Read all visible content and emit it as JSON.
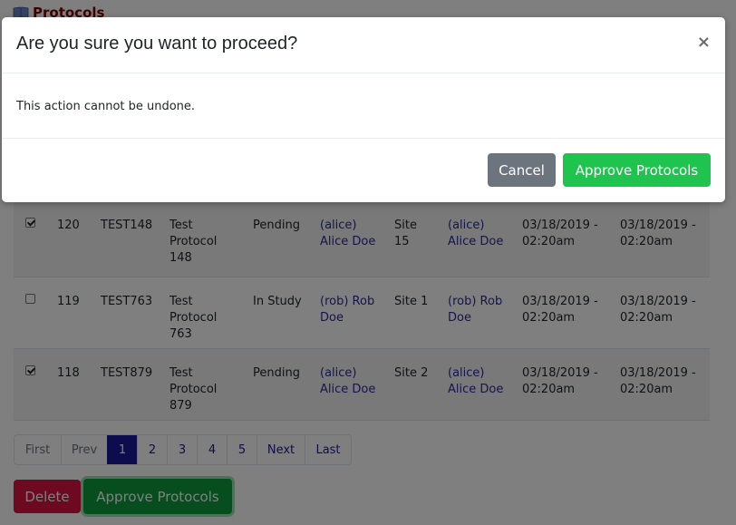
{
  "page": {
    "title": "Protocols"
  },
  "rows": [
    {
      "checked": true,
      "id": "120",
      "code": "TEST148",
      "name": [
        "Test",
        "Protocol",
        "148"
      ],
      "status": "Pending",
      "user": [
        "(alice)",
        "Alice Doe"
      ],
      "site": [
        "Site",
        "15"
      ],
      "user2": [
        "(alice)",
        "Alice Doe"
      ],
      "date1": [
        "03/18/2019 -",
        "02:20am"
      ],
      "date2": [
        "03/18/2019 -",
        "02:20am"
      ]
    },
    {
      "checked": false,
      "id": "119",
      "code": "TEST763",
      "name": [
        "Test",
        "Protocol",
        "763"
      ],
      "status": "In Study",
      "user": [
        "(rob) Rob",
        "Doe"
      ],
      "site": [
        "Site 1",
        ""
      ],
      "user2": [
        "(rob) Rob",
        "Doe"
      ],
      "date1": [
        "03/18/2019 -",
        "02:20am"
      ],
      "date2": [
        "03/18/2019 -",
        "02:20am"
      ]
    },
    {
      "checked": true,
      "id": "118",
      "code": "TEST879",
      "name": [
        "Test",
        "Protocol",
        "879"
      ],
      "status": "Pending",
      "user": [
        "(alice)",
        "Alice Doe"
      ],
      "site": [
        "Site 2",
        ""
      ],
      "user2": [
        "(alice)",
        "Alice Doe"
      ],
      "date1": [
        "03/18/2019 -",
        "02:20am"
      ],
      "date2": [
        "03/18/2019 -",
        "02:20am"
      ]
    }
  ],
  "pagination": {
    "first": "First",
    "prev": "Prev",
    "pages": [
      "1",
      "2",
      "3",
      "4",
      "5"
    ],
    "active": "1",
    "next": "Next",
    "last": "Last"
  },
  "actions": {
    "delete": "Delete",
    "approve": "Approve Protocols"
  },
  "modal": {
    "title": "Are you sure you want to proceed?",
    "close": "×",
    "body": "This action cannot be undone.",
    "cancel": "Cancel",
    "confirm": "Approve Protocols"
  },
  "colors": {
    "header": "#800000",
    "link": "#2a2a9c",
    "primary": "#1a1a9a",
    "danger": "#dc1244",
    "success": "#1fc44f",
    "secondary": "#6c757d"
  }
}
